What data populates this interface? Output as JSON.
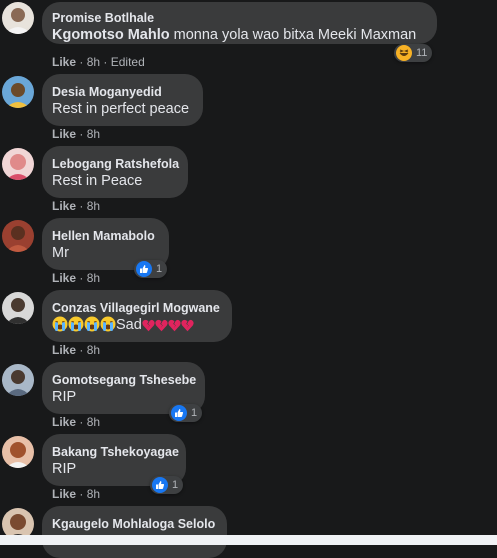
{
  "comments": [
    {
      "author": "Promise Botlhale",
      "mention": "Kgomotso Mahlo",
      "text": " monna yola wao bitxa Meeki Maxman",
      "like": "Like",
      "time": "8h",
      "edited": "Edited",
      "reaction": "haha",
      "reaction_count": "11"
    },
    {
      "author": "Desia Moganyedid",
      "text": "Rest in perfect peace",
      "like": "Like",
      "time": "8h"
    },
    {
      "author": "Lebogang Ratshefola",
      "text": "Rest in Peace",
      "like": "Like",
      "time": "8h"
    },
    {
      "author": "Hellen Mamabolo",
      "text": "Mr",
      "like": "Like",
      "time": "8h",
      "reaction": "like",
      "reaction_count": "1"
    },
    {
      "author": "Conzas Villagegirl Mogwane",
      "text": "Sad",
      "emojis_before": [
        "loudly-crying-face",
        "loudly-crying-face",
        "loudly-crying-face",
        "loudly-crying-face"
      ],
      "emojis_after": [
        "broken-heart",
        "broken-heart",
        "broken-heart",
        "broken-heart"
      ],
      "like": "Like",
      "time": "8h"
    },
    {
      "author": "Gomotsegang Tshesebe",
      "text": "RIP",
      "like": "Like",
      "time": "8h",
      "reaction": "like",
      "reaction_count": "1"
    },
    {
      "author": "Bakang Tshekoyagae",
      "text": "RIP",
      "like": "Like",
      "time": "8h",
      "reaction": "like",
      "reaction_count": "1"
    },
    {
      "author": "Kgaugelo Mohlaloga Selolo"
    }
  ],
  "colors": {
    "background": "#18191a",
    "bubble": "#3a3b3c",
    "meta_text": "#b0b3b8",
    "like_blue": "#1877f2",
    "haha_yellow": "#f7b125",
    "heart_red": "#e0245e"
  }
}
